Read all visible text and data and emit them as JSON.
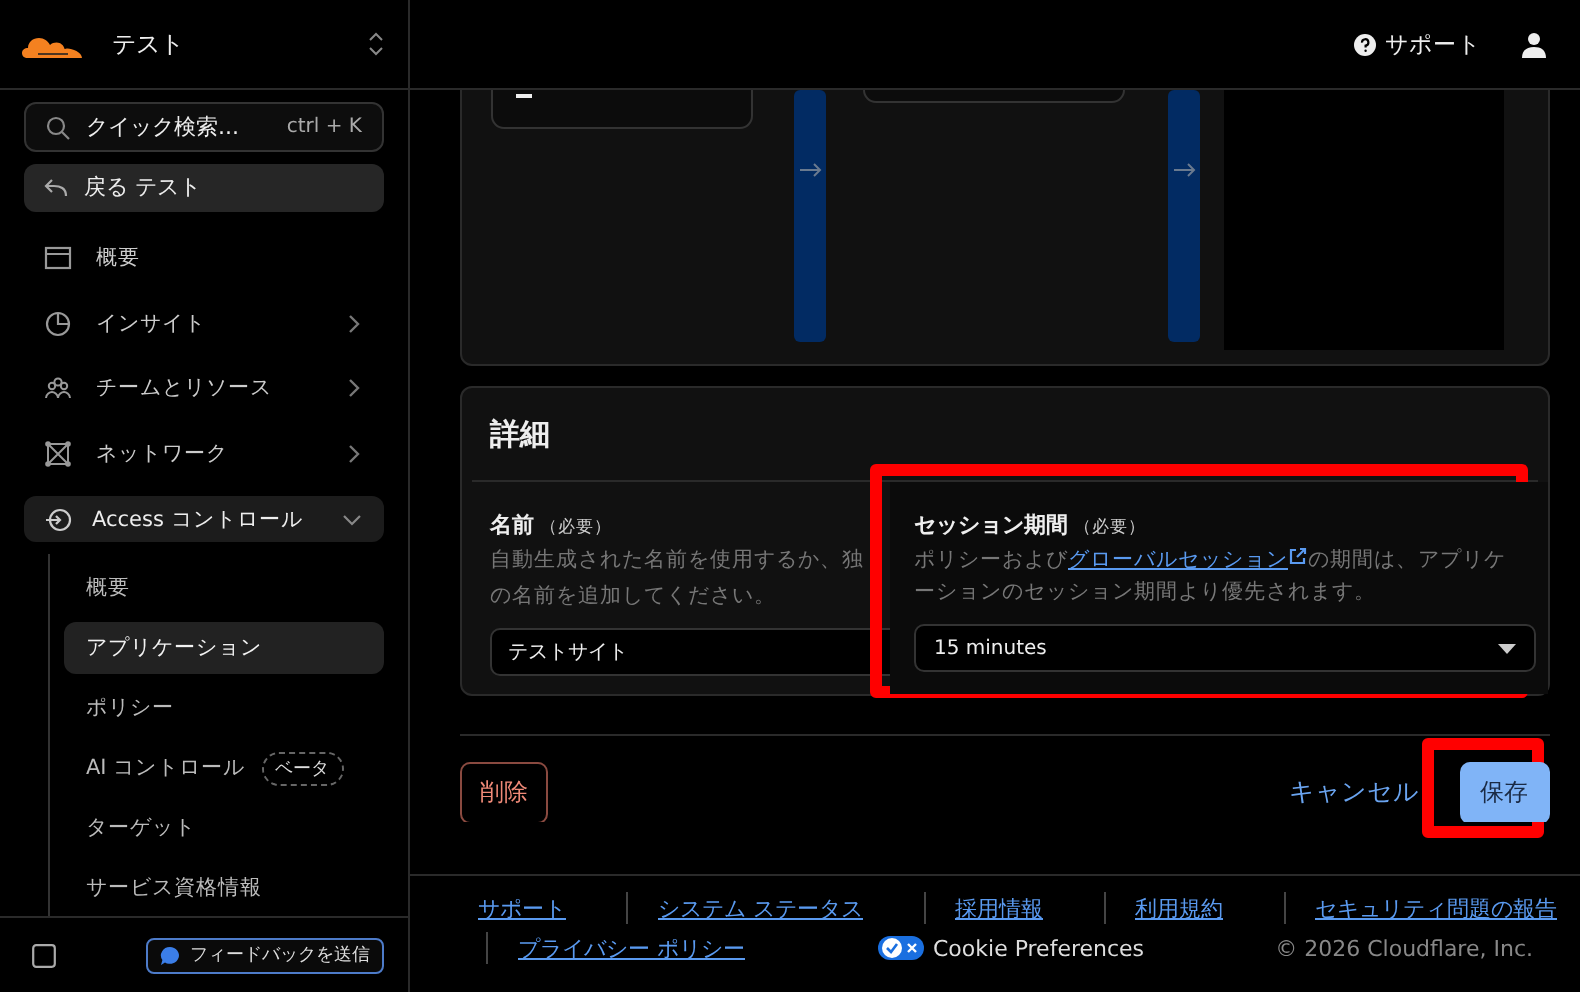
{
  "account": {
    "name": "テスト"
  },
  "search": {
    "placeholder": "クイック検索...",
    "shortcut": "ctrl + K"
  },
  "back": {
    "label": "戻る テスト"
  },
  "nav": [
    {
      "label": "概要",
      "kind": "window",
      "expandable": false
    },
    {
      "label": "インサイト",
      "kind": "chart",
      "expandable": true
    },
    {
      "label": "チームとリソース",
      "kind": "people",
      "expandable": true
    },
    {
      "label": "ネットワーク",
      "kind": "network",
      "expandable": true
    }
  ],
  "access_control": {
    "label": "Access コントロール",
    "expanded": true,
    "children": [
      {
        "label": "概要",
        "selected": false
      },
      {
        "label": "アプリケーション",
        "selected": true
      },
      {
        "label": "ポリシー",
        "selected": false
      },
      {
        "label": "AI コントロール",
        "badge": "ベータ",
        "selected": false
      },
      {
        "label": "ターゲット",
        "selected": false
      },
      {
        "label": "サービス資格情報",
        "selected": false
      }
    ]
  },
  "feedback": {
    "label": "フィードバックを送信"
  },
  "header": {
    "support": "サポート"
  },
  "details": {
    "title": "詳細",
    "name_field": {
      "label": "名前",
      "required": "（必要）",
      "description_lines": [
        "自動生成された名前を使用するか、独",
        "の名前を追加してください。"
      ],
      "value": "テストサイト"
    },
    "session_field": {
      "label": "セッション期間",
      "required": "（必要）",
      "description_before": "ポリシーおよび",
      "link": "グローバルセッション",
      "description_after": "の期間は、アプリケーションのセッション期間より優先されます。",
      "value": "15 minutes",
      "highlighted": true
    }
  },
  "actions": {
    "delete": "削除",
    "cancel": "キャンセル",
    "save": {
      "label": "保存",
      "highlighted": true
    }
  },
  "footer": {
    "links": [
      "サポート",
      "システム ステータス",
      "採用情報",
      "利用規約",
      "セキュリティ問題の報告",
      "プライバシー ポリシー"
    ],
    "cookie": "Cookie Preferences",
    "copyright": "© 2026 Cloudflare, Inc."
  }
}
